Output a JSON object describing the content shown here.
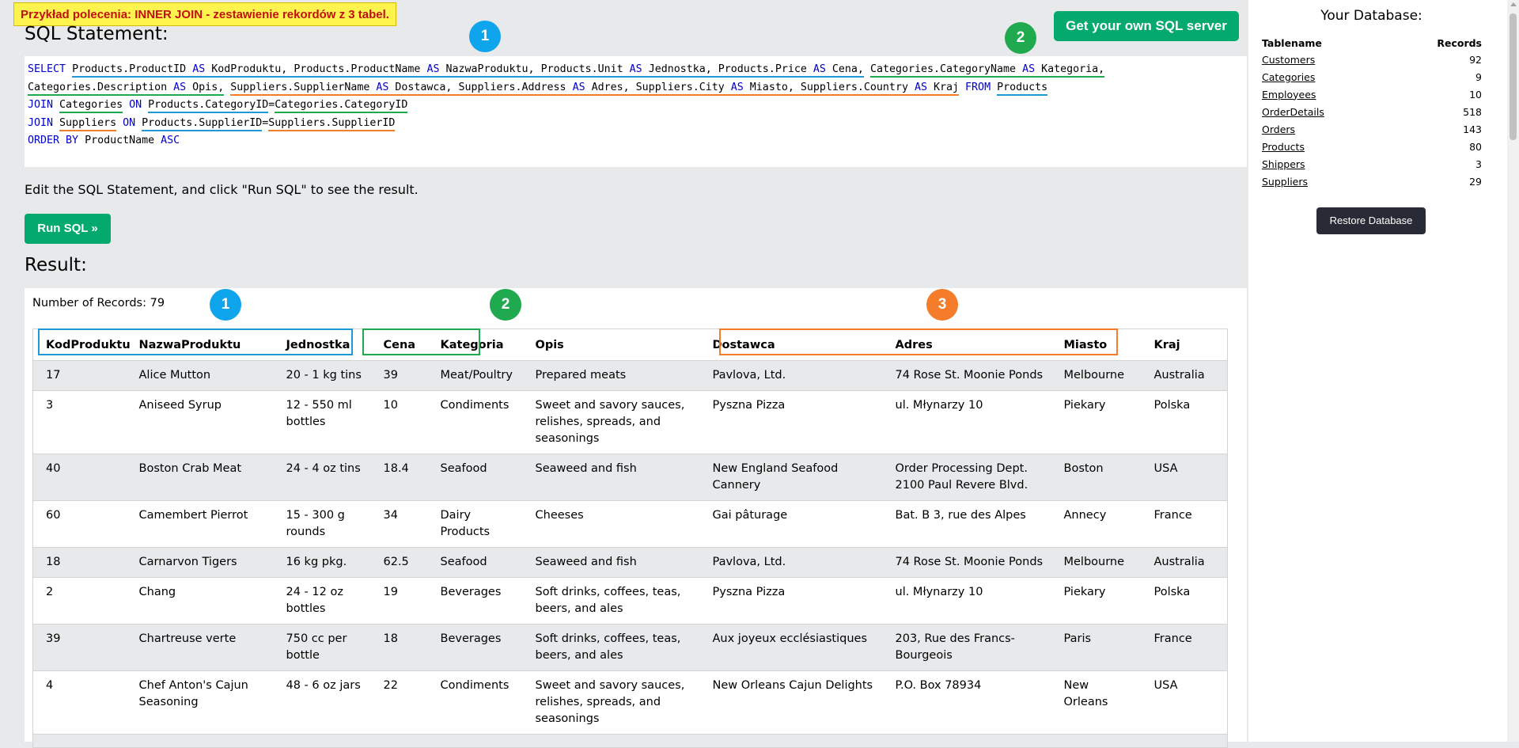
{
  "banner": "Przykład polecenia: INNER JOIN - zestawienie rekordów z 3 tabel.",
  "get_server_label": "Get your own SQL server",
  "sql_heading": "SQL Statement:",
  "badges": [
    "1",
    "2",
    "3"
  ],
  "sql": {
    "l1": {
      "select": "SELECT",
      "c1": "Products.ProductID",
      "as": "AS",
      "a1": "KodProduktu,",
      "c2": "Products.ProductName",
      "a2": "NazwaProduktu,",
      "c3": "Products.Unit",
      "a3": "Jednostka,",
      "c4": "Products.Price",
      "a4": "Cena,",
      "c5": "Categories.CategoryName",
      "a5": "Kategoria,"
    },
    "l2": {
      "c6": "Categories.Description",
      "a6": "Opis,",
      "c7": "Suppliers.SupplierName",
      "a7": "Dostawca,",
      "c8": "Suppliers.Address",
      "a8": "Adres,",
      "c9": "Suppliers.City",
      "a9": "Miasto,",
      "c10": "Suppliers.Country",
      "a10": "Kraj",
      "from": "FROM",
      "table": "Products"
    },
    "l3": {
      "join": "JOIN",
      "table": "Categories",
      "on": "ON",
      "left": "Products.CategoryID",
      "eq": "=",
      "right": "Categories.CategoryID"
    },
    "l4": {
      "join": "JOIN",
      "table": "Suppliers",
      "on": "ON",
      "left": "Products.SupplierID",
      "eq": "=",
      "right": "Suppliers.SupplierID"
    },
    "l5": {
      "order": "ORDER BY",
      "col": "ProductName",
      "dir": "ASC"
    }
  },
  "edit_hint": "Edit the SQL Statement, and click \"Run SQL\" to see the result.",
  "run_label": "Run SQL »",
  "result_heading": "Result:",
  "num_records": "Number of Records: 79",
  "columns": [
    "KodProduktu",
    "NazwaProduktu",
    "Jednostka",
    "Cena",
    "Kategoria",
    "Opis",
    "Dostawca",
    "Adres",
    "Miasto",
    "Kraj"
  ],
  "rows": [
    [
      "17",
      "Alice Mutton",
      "20 - 1 kg tins",
      "39",
      "Meat/Poultry",
      "Prepared meats",
      "Pavlova, Ltd.",
      "74 Rose St. Moonie Ponds",
      "Melbourne",
      "Australia"
    ],
    [
      "3",
      "Aniseed Syrup",
      "12 - 550 ml bottles",
      "10",
      "Condiments",
      "Sweet and savory sauces, relishes, spreads, and seasonings",
      "Pyszna Pizza",
      "ul. Młynarzy 10",
      "Piekary",
      "Polska"
    ],
    [
      "40",
      "Boston Crab Meat",
      "24 - 4 oz tins",
      "18.4",
      "Seafood",
      "Seaweed and fish",
      "New England Seafood Cannery",
      "Order Processing Dept. 2100 Paul Revere Blvd.",
      "Boston",
      "USA"
    ],
    [
      "60",
      "Camembert Pierrot",
      "15 - 300 g rounds",
      "34",
      "Dairy Products",
      "Cheeses",
      "Gai pâturage",
      "Bat. B 3, rue des Alpes",
      "Annecy",
      "France"
    ],
    [
      "18",
      "Carnarvon Tigers",
      "16 kg pkg.",
      "62.5",
      "Seafood",
      "Seaweed and fish",
      "Pavlova, Ltd.",
      "74 Rose St. Moonie Ponds",
      "Melbourne",
      "Australia"
    ],
    [
      "2",
      "Chang",
      "24 - 12 oz bottles",
      "19",
      "Beverages",
      "Soft drinks, coffees, teas, beers, and ales",
      "Pyszna Pizza",
      "ul. Młynarzy 10",
      "Piekary",
      "Polska"
    ],
    [
      "39",
      "Chartreuse verte",
      "750 cc per bottle",
      "18",
      "Beverages",
      "Soft drinks, coffees, teas, beers, and ales",
      "Aux joyeux ecclésiastiques",
      "203, Rue des Francs-Bourgeois",
      "Paris",
      "France"
    ],
    [
      "4",
      "Chef Anton's Cajun Seasoning",
      "48 - 6 oz jars",
      "22",
      "Condiments",
      "Sweet and savory sauces, relishes, spreads, and seasonings",
      "New Orleans Cajun Delights",
      "P.O. Box 78934",
      "New Orleans",
      "USA"
    ],
    [
      "",
      "",
      "",
      "",
      "",
      "",
      "",
      "",
      "",
      ""
    ]
  ],
  "sidebar": {
    "title": "Your Database:",
    "col_name": "Tablename",
    "col_records": "Records",
    "tables": [
      {
        "name": "Customers",
        "records": "92"
      },
      {
        "name": "Categories",
        "records": "9"
      },
      {
        "name": "Employees",
        "records": "10"
      },
      {
        "name": "OrderDetails",
        "records": "518"
      },
      {
        "name": "Orders",
        "records": "143"
      },
      {
        "name": "Products",
        "records": "80"
      },
      {
        "name": "Shippers",
        "records": "3"
      },
      {
        "name": "Suppliers",
        "records": "29"
      }
    ],
    "restore_label": "Restore Database"
  },
  "colors": {
    "accent_green": "#04aa6d",
    "blue": "#0ea5ec",
    "green": "#1faa4f",
    "orange": "#f57c2a",
    "keyword": "#0000cd"
  }
}
